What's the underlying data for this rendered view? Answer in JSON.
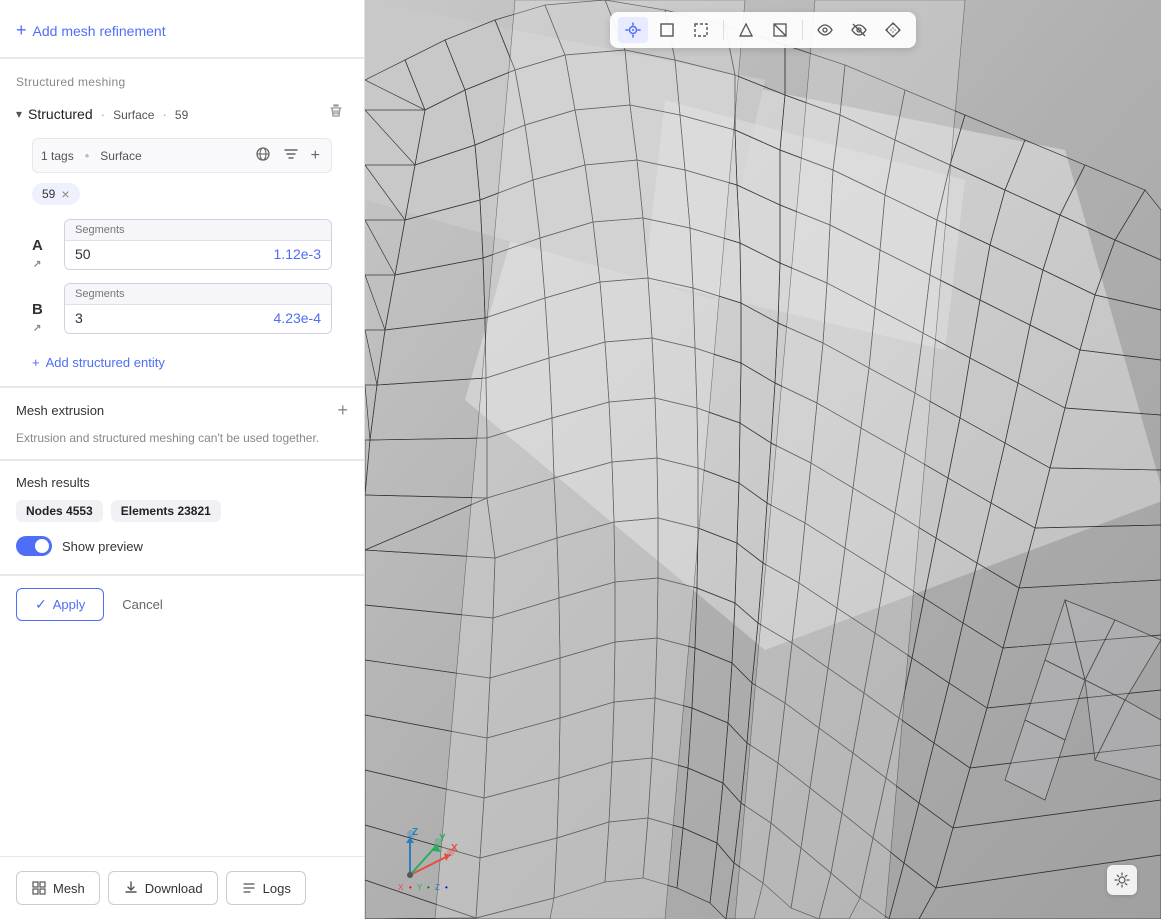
{
  "sidebar": {
    "add_mesh_refinement_label": "Add mesh refinement",
    "structured_meshing_label": "Structured meshing",
    "structured_item": {
      "title": "Structured",
      "dot1": "·",
      "surface": "Surface",
      "dot2": "·",
      "number": "59",
      "tags_label": "1 tags",
      "bullet": "•",
      "surface_text": "Surface",
      "tag_chip_value": "59",
      "axis_a": {
        "label": "A",
        "segments_label": "Segments",
        "segments_count": "50",
        "segments_value": "1.12e-3"
      },
      "axis_b": {
        "label": "B",
        "segments_label": "Segments",
        "segments_count": "3",
        "segments_value": "4.23e-4"
      },
      "add_structured_entity_label": "Add structured entity"
    },
    "mesh_extrusion": {
      "label": "Mesh extrusion",
      "warning": "Extrusion and structured meshing can't be used together."
    },
    "mesh_results": {
      "label": "Mesh results",
      "nodes_label": "Nodes",
      "nodes_value": "4553",
      "elements_label": "Elements",
      "elements_value": "23821",
      "show_preview_label": "Show preview",
      "preview_active": true
    },
    "apply_btn_label": "Apply",
    "cancel_btn_label": "Cancel",
    "mesh_btn_label": "Mesh",
    "download_btn_label": "Download",
    "logs_btn_label": "Logs"
  },
  "viewport": {
    "toolbar_buttons": [
      {
        "id": "camera",
        "icon": "⊙",
        "tooltip": "Camera",
        "active": true
      },
      {
        "id": "box-select",
        "icon": "□",
        "tooltip": "Box select",
        "active": false
      },
      {
        "id": "lasso-select",
        "icon": "◻",
        "tooltip": "Lasso",
        "active": false
      },
      {
        "id": "vertex",
        "icon": "⊛",
        "tooltip": "Vertex",
        "active": false
      },
      {
        "id": "edge",
        "icon": "⊞",
        "tooltip": "Edge",
        "active": false
      },
      {
        "id": "face",
        "icon": "⊟",
        "tooltip": "Face",
        "active": false
      },
      {
        "id": "view1",
        "icon": "◑",
        "tooltip": "View1",
        "active": false
      },
      {
        "id": "view2",
        "icon": "◒",
        "tooltip": "View2",
        "active": false
      },
      {
        "id": "filter",
        "icon": "◈",
        "tooltip": "Filter",
        "active": false
      }
    ],
    "top_right_btn": "⬡"
  }
}
